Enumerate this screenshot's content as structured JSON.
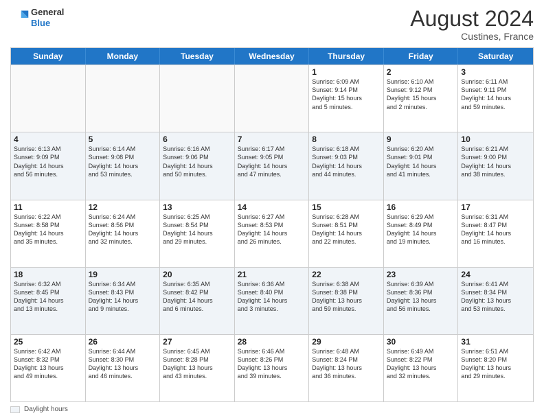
{
  "header": {
    "logo_line1": "General",
    "logo_line2": "Blue",
    "month_title": "August 2024",
    "subtitle": "Custines, France"
  },
  "days_of_week": [
    "Sunday",
    "Monday",
    "Tuesday",
    "Wednesday",
    "Thursday",
    "Friday",
    "Saturday"
  ],
  "legend_label": "Daylight hours",
  "weeks": [
    [
      {
        "day": "",
        "text": "",
        "empty": true
      },
      {
        "day": "",
        "text": "",
        "empty": true
      },
      {
        "day": "",
        "text": "",
        "empty": true
      },
      {
        "day": "",
        "text": "",
        "empty": true
      },
      {
        "day": "1",
        "text": "Sunrise: 6:09 AM\nSunset: 9:14 PM\nDaylight: 15 hours\nand 5 minutes."
      },
      {
        "day": "2",
        "text": "Sunrise: 6:10 AM\nSunset: 9:12 PM\nDaylight: 15 hours\nand 2 minutes."
      },
      {
        "day": "3",
        "text": "Sunrise: 6:11 AM\nSunset: 9:11 PM\nDaylight: 14 hours\nand 59 minutes."
      }
    ],
    [
      {
        "day": "4",
        "text": "Sunrise: 6:13 AM\nSunset: 9:09 PM\nDaylight: 14 hours\nand 56 minutes."
      },
      {
        "day": "5",
        "text": "Sunrise: 6:14 AM\nSunset: 9:08 PM\nDaylight: 14 hours\nand 53 minutes."
      },
      {
        "day": "6",
        "text": "Sunrise: 6:16 AM\nSunset: 9:06 PM\nDaylight: 14 hours\nand 50 minutes."
      },
      {
        "day": "7",
        "text": "Sunrise: 6:17 AM\nSunset: 9:05 PM\nDaylight: 14 hours\nand 47 minutes."
      },
      {
        "day": "8",
        "text": "Sunrise: 6:18 AM\nSunset: 9:03 PM\nDaylight: 14 hours\nand 44 minutes."
      },
      {
        "day": "9",
        "text": "Sunrise: 6:20 AM\nSunset: 9:01 PM\nDaylight: 14 hours\nand 41 minutes."
      },
      {
        "day": "10",
        "text": "Sunrise: 6:21 AM\nSunset: 9:00 PM\nDaylight: 14 hours\nand 38 minutes."
      }
    ],
    [
      {
        "day": "11",
        "text": "Sunrise: 6:22 AM\nSunset: 8:58 PM\nDaylight: 14 hours\nand 35 minutes."
      },
      {
        "day": "12",
        "text": "Sunrise: 6:24 AM\nSunset: 8:56 PM\nDaylight: 14 hours\nand 32 minutes."
      },
      {
        "day": "13",
        "text": "Sunrise: 6:25 AM\nSunset: 8:54 PM\nDaylight: 14 hours\nand 29 minutes."
      },
      {
        "day": "14",
        "text": "Sunrise: 6:27 AM\nSunset: 8:53 PM\nDaylight: 14 hours\nand 26 minutes."
      },
      {
        "day": "15",
        "text": "Sunrise: 6:28 AM\nSunset: 8:51 PM\nDaylight: 14 hours\nand 22 minutes."
      },
      {
        "day": "16",
        "text": "Sunrise: 6:29 AM\nSunset: 8:49 PM\nDaylight: 14 hours\nand 19 minutes."
      },
      {
        "day": "17",
        "text": "Sunrise: 6:31 AM\nSunset: 8:47 PM\nDaylight: 14 hours\nand 16 minutes."
      }
    ],
    [
      {
        "day": "18",
        "text": "Sunrise: 6:32 AM\nSunset: 8:45 PM\nDaylight: 14 hours\nand 13 minutes."
      },
      {
        "day": "19",
        "text": "Sunrise: 6:34 AM\nSunset: 8:43 PM\nDaylight: 14 hours\nand 9 minutes."
      },
      {
        "day": "20",
        "text": "Sunrise: 6:35 AM\nSunset: 8:42 PM\nDaylight: 14 hours\nand 6 minutes."
      },
      {
        "day": "21",
        "text": "Sunrise: 6:36 AM\nSunset: 8:40 PM\nDaylight: 14 hours\nand 3 minutes."
      },
      {
        "day": "22",
        "text": "Sunrise: 6:38 AM\nSunset: 8:38 PM\nDaylight: 13 hours\nand 59 minutes."
      },
      {
        "day": "23",
        "text": "Sunrise: 6:39 AM\nSunset: 8:36 PM\nDaylight: 13 hours\nand 56 minutes."
      },
      {
        "day": "24",
        "text": "Sunrise: 6:41 AM\nSunset: 8:34 PM\nDaylight: 13 hours\nand 53 minutes."
      }
    ],
    [
      {
        "day": "25",
        "text": "Sunrise: 6:42 AM\nSunset: 8:32 PM\nDaylight: 13 hours\nand 49 minutes."
      },
      {
        "day": "26",
        "text": "Sunrise: 6:44 AM\nSunset: 8:30 PM\nDaylight: 13 hours\nand 46 minutes."
      },
      {
        "day": "27",
        "text": "Sunrise: 6:45 AM\nSunset: 8:28 PM\nDaylight: 13 hours\nand 43 minutes."
      },
      {
        "day": "28",
        "text": "Sunrise: 6:46 AM\nSunset: 8:26 PM\nDaylight: 13 hours\nand 39 minutes."
      },
      {
        "day": "29",
        "text": "Sunrise: 6:48 AM\nSunset: 8:24 PM\nDaylight: 13 hours\nand 36 minutes."
      },
      {
        "day": "30",
        "text": "Sunrise: 6:49 AM\nSunset: 8:22 PM\nDaylight: 13 hours\nand 32 minutes."
      },
      {
        "day": "31",
        "text": "Sunrise: 6:51 AM\nSunset: 8:20 PM\nDaylight: 13 hours\nand 29 minutes."
      }
    ]
  ]
}
